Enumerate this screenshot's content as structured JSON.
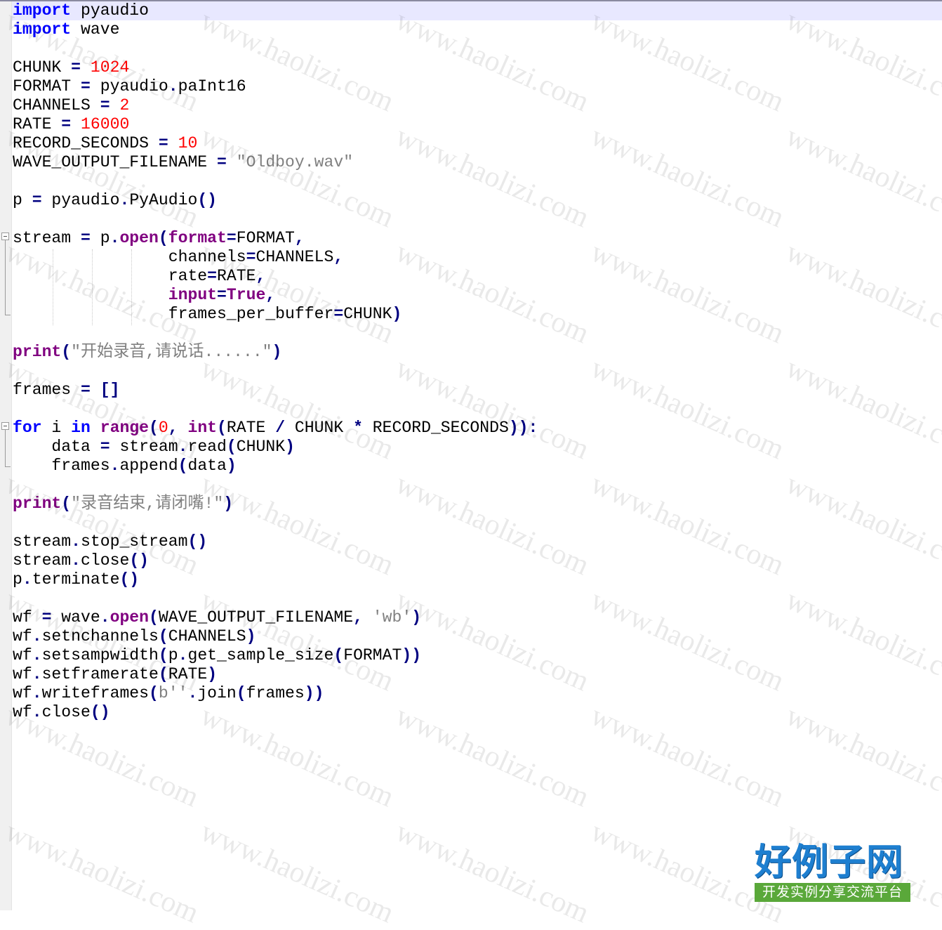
{
  "editor": {
    "language": "python",
    "colors": {
      "keyword": "#0000ff",
      "builtin": "#800080",
      "number": "#ff0000",
      "string": "#808080",
      "operator": "#000080",
      "default": "#000000",
      "caret_line": "#e8e8ff",
      "gutter": "#f0f0f0"
    },
    "lines": [
      [
        {
          "t": "import",
          "c": "kw"
        },
        {
          "t": " pyaudio"
        }
      ],
      [
        {
          "t": "import",
          "c": "kw"
        },
        {
          "t": " wave"
        }
      ],
      [],
      [
        {
          "t": "CHUNK "
        },
        {
          "t": "=",
          "c": "op"
        },
        {
          "t": " "
        },
        {
          "t": "1024",
          "c": "num"
        }
      ],
      [
        {
          "t": "FORMAT "
        },
        {
          "t": "=",
          "c": "op"
        },
        {
          "t": " pyaudio"
        },
        {
          "t": ".",
          "c": "op"
        },
        {
          "t": "paInt16"
        }
      ],
      [
        {
          "t": "CHANNELS "
        },
        {
          "t": "=",
          "c": "op"
        },
        {
          "t": " "
        },
        {
          "t": "2",
          "c": "num"
        }
      ],
      [
        {
          "t": "RATE "
        },
        {
          "t": "=",
          "c": "op"
        },
        {
          "t": " "
        },
        {
          "t": "16000",
          "c": "num"
        }
      ],
      [
        {
          "t": "RECORD_SECONDS "
        },
        {
          "t": "=",
          "c": "op"
        },
        {
          "t": " "
        },
        {
          "t": "10",
          "c": "num"
        }
      ],
      [
        {
          "t": "WAVE_OUTPUT_FILENAME "
        },
        {
          "t": "=",
          "c": "op"
        },
        {
          "t": " "
        },
        {
          "t": "\"Oldboy.wav\"",
          "c": "str"
        }
      ],
      [],
      [
        {
          "t": "p "
        },
        {
          "t": "=",
          "c": "op"
        },
        {
          "t": " pyaudio"
        },
        {
          "t": ".",
          "c": "op"
        },
        {
          "t": "PyAudio"
        },
        {
          "t": "()",
          "c": "op"
        }
      ],
      [],
      [
        {
          "t": "stream "
        },
        {
          "t": "=",
          "c": "op"
        },
        {
          "t": " p"
        },
        {
          "t": ".",
          "c": "op"
        },
        {
          "t": "open",
          "c": "bi"
        },
        {
          "t": "(",
          "c": "op"
        },
        {
          "t": "format",
          "c": "bi"
        },
        {
          "t": "=",
          "c": "op"
        },
        {
          "t": "FORMAT"
        },
        {
          "t": ",",
          "c": "op"
        }
      ],
      [
        {
          "t": "                channels"
        },
        {
          "t": "=",
          "c": "op"
        },
        {
          "t": "CHANNELS"
        },
        {
          "t": ",",
          "c": "op"
        }
      ],
      [
        {
          "t": "                rate"
        },
        {
          "t": "=",
          "c": "op"
        },
        {
          "t": "RATE"
        },
        {
          "t": ",",
          "c": "op"
        }
      ],
      [
        {
          "t": "                "
        },
        {
          "t": "input",
          "c": "bi"
        },
        {
          "t": "=",
          "c": "op"
        },
        {
          "t": "True",
          "c": "bi"
        },
        {
          "t": ",",
          "c": "op"
        }
      ],
      [
        {
          "t": "                frames_per_buffer"
        },
        {
          "t": "=",
          "c": "op"
        },
        {
          "t": "CHUNK"
        },
        {
          "t": ")",
          "c": "op"
        }
      ],
      [],
      [
        {
          "t": "print",
          "c": "bi"
        },
        {
          "t": "(",
          "c": "op"
        },
        {
          "t": "\"开始录音,请说话......\"",
          "c": "str"
        },
        {
          "t": ")",
          "c": "op"
        }
      ],
      [],
      [
        {
          "t": "frames "
        },
        {
          "t": "=",
          "c": "op"
        },
        {
          "t": " "
        },
        {
          "t": "[]",
          "c": "op"
        }
      ],
      [],
      [
        {
          "t": "for",
          "c": "kw"
        },
        {
          "t": " i "
        },
        {
          "t": "in",
          "c": "kw"
        },
        {
          "t": " "
        },
        {
          "t": "range",
          "c": "bi"
        },
        {
          "t": "(",
          "c": "op"
        },
        {
          "t": "0",
          "c": "num"
        },
        {
          "t": ",",
          "c": "op"
        },
        {
          "t": " "
        },
        {
          "t": "int",
          "c": "bi"
        },
        {
          "t": "(",
          "c": "op"
        },
        {
          "t": "RATE "
        },
        {
          "t": "/",
          "c": "op"
        },
        {
          "t": " CHUNK "
        },
        {
          "t": "*",
          "c": "op"
        },
        {
          "t": " RECORD_SECONDS"
        },
        {
          "t": ")):",
          "c": "op"
        }
      ],
      [
        {
          "t": "    data "
        },
        {
          "t": "=",
          "c": "op"
        },
        {
          "t": " stream"
        },
        {
          "t": ".",
          "c": "op"
        },
        {
          "t": "read"
        },
        {
          "t": "(",
          "c": "op"
        },
        {
          "t": "CHUNK"
        },
        {
          "t": ")",
          "c": "op"
        }
      ],
      [
        {
          "t": "    frames"
        },
        {
          "t": ".",
          "c": "op"
        },
        {
          "t": "append"
        },
        {
          "t": "(",
          "c": "op"
        },
        {
          "t": "data"
        },
        {
          "t": ")",
          "c": "op"
        }
      ],
      [],
      [
        {
          "t": "print",
          "c": "bi"
        },
        {
          "t": "(",
          "c": "op"
        },
        {
          "t": "\"录音结束,请闭嘴!\"",
          "c": "str"
        },
        {
          "t": ")",
          "c": "op"
        }
      ],
      [],
      [
        {
          "t": "stream"
        },
        {
          "t": ".",
          "c": "op"
        },
        {
          "t": "stop_stream"
        },
        {
          "t": "()",
          "c": "op"
        }
      ],
      [
        {
          "t": "stream"
        },
        {
          "t": ".",
          "c": "op"
        },
        {
          "t": "close"
        },
        {
          "t": "()",
          "c": "op"
        }
      ],
      [
        {
          "t": "p"
        },
        {
          "t": ".",
          "c": "op"
        },
        {
          "t": "terminate"
        },
        {
          "t": "()",
          "c": "op"
        }
      ],
      [],
      [
        {
          "t": "wf "
        },
        {
          "t": "=",
          "c": "op"
        },
        {
          "t": " wave"
        },
        {
          "t": ".",
          "c": "op"
        },
        {
          "t": "open",
          "c": "bi"
        },
        {
          "t": "(",
          "c": "op"
        },
        {
          "t": "WAVE_OUTPUT_FILENAME"
        },
        {
          "t": ",",
          "c": "op"
        },
        {
          "t": " "
        },
        {
          "t": "'wb'",
          "c": "str"
        },
        {
          "t": ")",
          "c": "op"
        }
      ],
      [
        {
          "t": "wf"
        },
        {
          "t": ".",
          "c": "op"
        },
        {
          "t": "setnchannels"
        },
        {
          "t": "(",
          "c": "op"
        },
        {
          "t": "CHANNELS"
        },
        {
          "t": ")",
          "c": "op"
        }
      ],
      [
        {
          "t": "wf"
        },
        {
          "t": ".",
          "c": "op"
        },
        {
          "t": "setsampwidth"
        },
        {
          "t": "(",
          "c": "op"
        },
        {
          "t": "p"
        },
        {
          "t": ".",
          "c": "op"
        },
        {
          "t": "get_sample_size"
        },
        {
          "t": "(",
          "c": "op"
        },
        {
          "t": "FORMAT"
        },
        {
          "t": "))",
          "c": "op"
        }
      ],
      [
        {
          "t": "wf"
        },
        {
          "t": ".",
          "c": "op"
        },
        {
          "t": "setframerate"
        },
        {
          "t": "(",
          "c": "op"
        },
        {
          "t": "RATE"
        },
        {
          "t": ")",
          "c": "op"
        }
      ],
      [
        {
          "t": "wf"
        },
        {
          "t": ".",
          "c": "op"
        },
        {
          "t": "writeframes"
        },
        {
          "t": "(",
          "c": "op"
        },
        {
          "t": "b''",
          "c": "str"
        },
        {
          "t": ".",
          "c": "op"
        },
        {
          "t": "join"
        },
        {
          "t": "(",
          "c": "op"
        },
        {
          "t": "frames"
        },
        {
          "t": "))",
          "c": "op"
        }
      ],
      [
        {
          "t": "wf"
        },
        {
          "t": ".",
          "c": "op"
        },
        {
          "t": "close"
        },
        {
          "t": "()",
          "c": "op"
        }
      ]
    ]
  },
  "watermark": {
    "text": "www.haolizi.com",
    "color": "#000000"
  },
  "logo": {
    "title": "好例子网",
    "subtitle": "开发实例分享交流平台",
    "title_color": "#1e7fd0",
    "subtitle_bg": "#5aa83a"
  }
}
